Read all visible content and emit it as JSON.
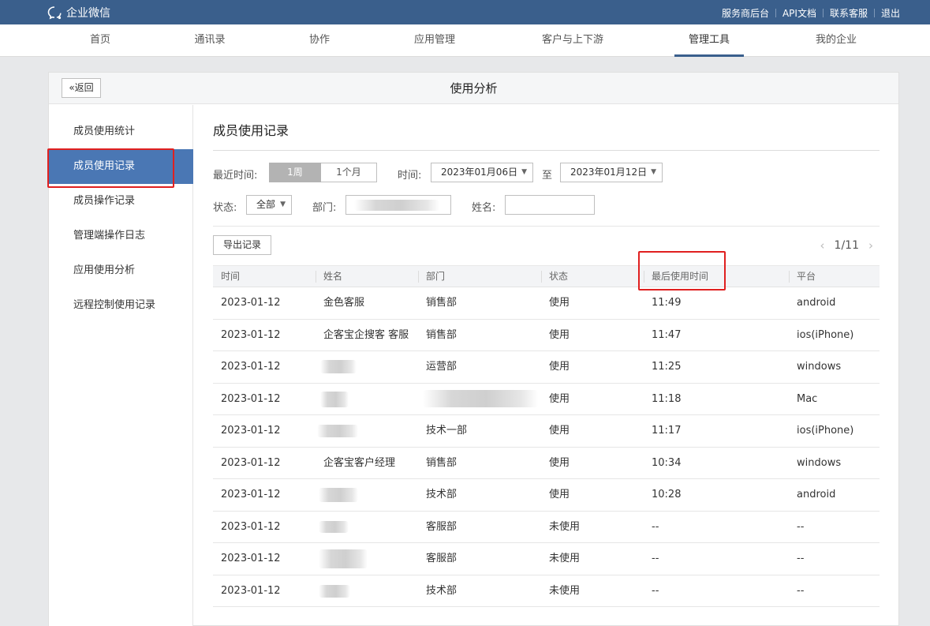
{
  "topbar": {
    "logo_text": "企业微信",
    "links": [
      "服务商后台",
      "API文档",
      "联系客服",
      "退出"
    ]
  },
  "nav": {
    "items": [
      "首页",
      "通讯录",
      "协作",
      "应用管理",
      "客户与上下游",
      "管理工具",
      "我的企业"
    ],
    "active": "管理工具"
  },
  "panel": {
    "back_label": "返回",
    "title": "使用分析"
  },
  "sidebar": {
    "items": [
      "成员使用统计",
      "成员使用记录",
      "成员操作记录",
      "管理端操作日志",
      "应用使用分析",
      "远程控制使用记录"
    ],
    "active": "成员使用记录"
  },
  "content": {
    "title": "成员使用记录",
    "filters": {
      "recent_label": "最近时间:",
      "week": "1周",
      "month": "1个月",
      "time_label": "时间:",
      "start_date": "2023年01月06日",
      "to_label": "至",
      "end_date": "2023年01月12日",
      "status_label": "状态:",
      "status_value": "全部",
      "dept_label": "部门:",
      "name_label": "姓名:",
      "name_value": ""
    },
    "export_label": "导出记录",
    "pager": "1/11"
  },
  "table": {
    "headers": [
      "时间",
      "姓名",
      "部门",
      "状态",
      "最后使用时间",
      "平台"
    ],
    "rows": [
      {
        "date": "2023-01-12",
        "name": "金色客服",
        "dept": "销售部",
        "status": "使用",
        "last": "11:49",
        "platform": "android"
      },
      {
        "date": "2023-01-12",
        "name": "企客宝企搜客 客服",
        "dept": "销售部",
        "status": "使用",
        "last": "11:47",
        "platform": "ios(iPhone)"
      },
      {
        "date": "2023-01-12",
        "name": "",
        "dept": "运营部",
        "status": "使用",
        "last": "11:25",
        "platform": "windows"
      },
      {
        "date": "2023-01-12",
        "name": "",
        "dept": "",
        "status": "使用",
        "last": "11:18",
        "platform": "Mac"
      },
      {
        "date": "2023-01-12",
        "name": "",
        "dept": "技术一部",
        "status": "使用",
        "last": "11:17",
        "platform": "ios(iPhone)"
      },
      {
        "date": "2023-01-12",
        "name": "企客宝客户经理",
        "dept": "销售部",
        "status": "使用",
        "last": "10:34",
        "platform": "windows"
      },
      {
        "date": "2023-01-12",
        "name": "",
        "dept": "技术部",
        "status": "使用",
        "last": "10:28",
        "platform": "android"
      },
      {
        "date": "2023-01-12",
        "name": "",
        "dept": "客服部",
        "status": "未使用",
        "last": "--",
        "platform": "--"
      },
      {
        "date": "2023-01-12",
        "name": "",
        "dept": "客服部",
        "status": "未使用",
        "last": "--",
        "platform": "--"
      },
      {
        "date": "2023-01-12",
        "name": "",
        "dept": "技术部",
        "status": "未使用",
        "last": "--",
        "platform": "--"
      }
    ]
  },
  "icons": {
    "logo": "chat-bubble-icon",
    "back": "double-chevron-left-icon",
    "pager_prev": "chevron-left-icon",
    "pager_next": "chevron-right-icon",
    "dropdown": "caret-down-icon"
  },
  "colors": {
    "topbar": "#3a5f8c",
    "sidebar_active": "#4a77b4",
    "highlight": "#e02020"
  }
}
